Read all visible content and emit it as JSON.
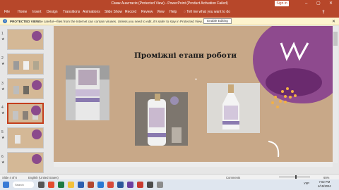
{
  "titlebar": {
    "title": "Сімак Анастасія (Protected View) - PowerPoint (Product Activation Failed)",
    "signin": "Sign in",
    "minimize": "–",
    "restore": "▢",
    "close": "✕"
  },
  "ribbon": {
    "tabs": [
      "File",
      "Home",
      "Insert",
      "Design",
      "Transitions",
      "Animations",
      "Slide Show",
      "Record",
      "Review",
      "View",
      "Help"
    ],
    "tell_me": "Tell me what you want to do",
    "share": "⇪"
  },
  "protected_view": {
    "label": "PROTECTED VIEW",
    "message": "Be careful—files from the Internet can contain viruses. Unless you need to edit, it's safer to stay in Protected View.",
    "button": "Enable Editing",
    "close": "✕"
  },
  "thumbnails": [
    {
      "num": "1",
      "star": "★"
    },
    {
      "num": "2",
      "star": "★"
    },
    {
      "num": "3",
      "star": "★"
    },
    {
      "num": "4",
      "star": "★"
    },
    {
      "num": "5",
      "star": "★"
    },
    {
      "num": "6",
      "star": "★"
    }
  ],
  "slide": {
    "title": "Проміжні етапи роботи"
  },
  "statusbar": {
    "slide_info": "Slide 4 of 6",
    "language": "English (United States)",
    "comments": "Comments",
    "zoom": "65%"
  },
  "taskbar": {
    "search_placeholder": "Search",
    "tray_lang": "УКР",
    "time": "7:02 PM",
    "date": "4/15/2024"
  },
  "colors": {
    "accent": "#b7472a",
    "slide_bg": "#c8a888",
    "blob": "#8e4a8e",
    "dots": "#f2b046"
  }
}
